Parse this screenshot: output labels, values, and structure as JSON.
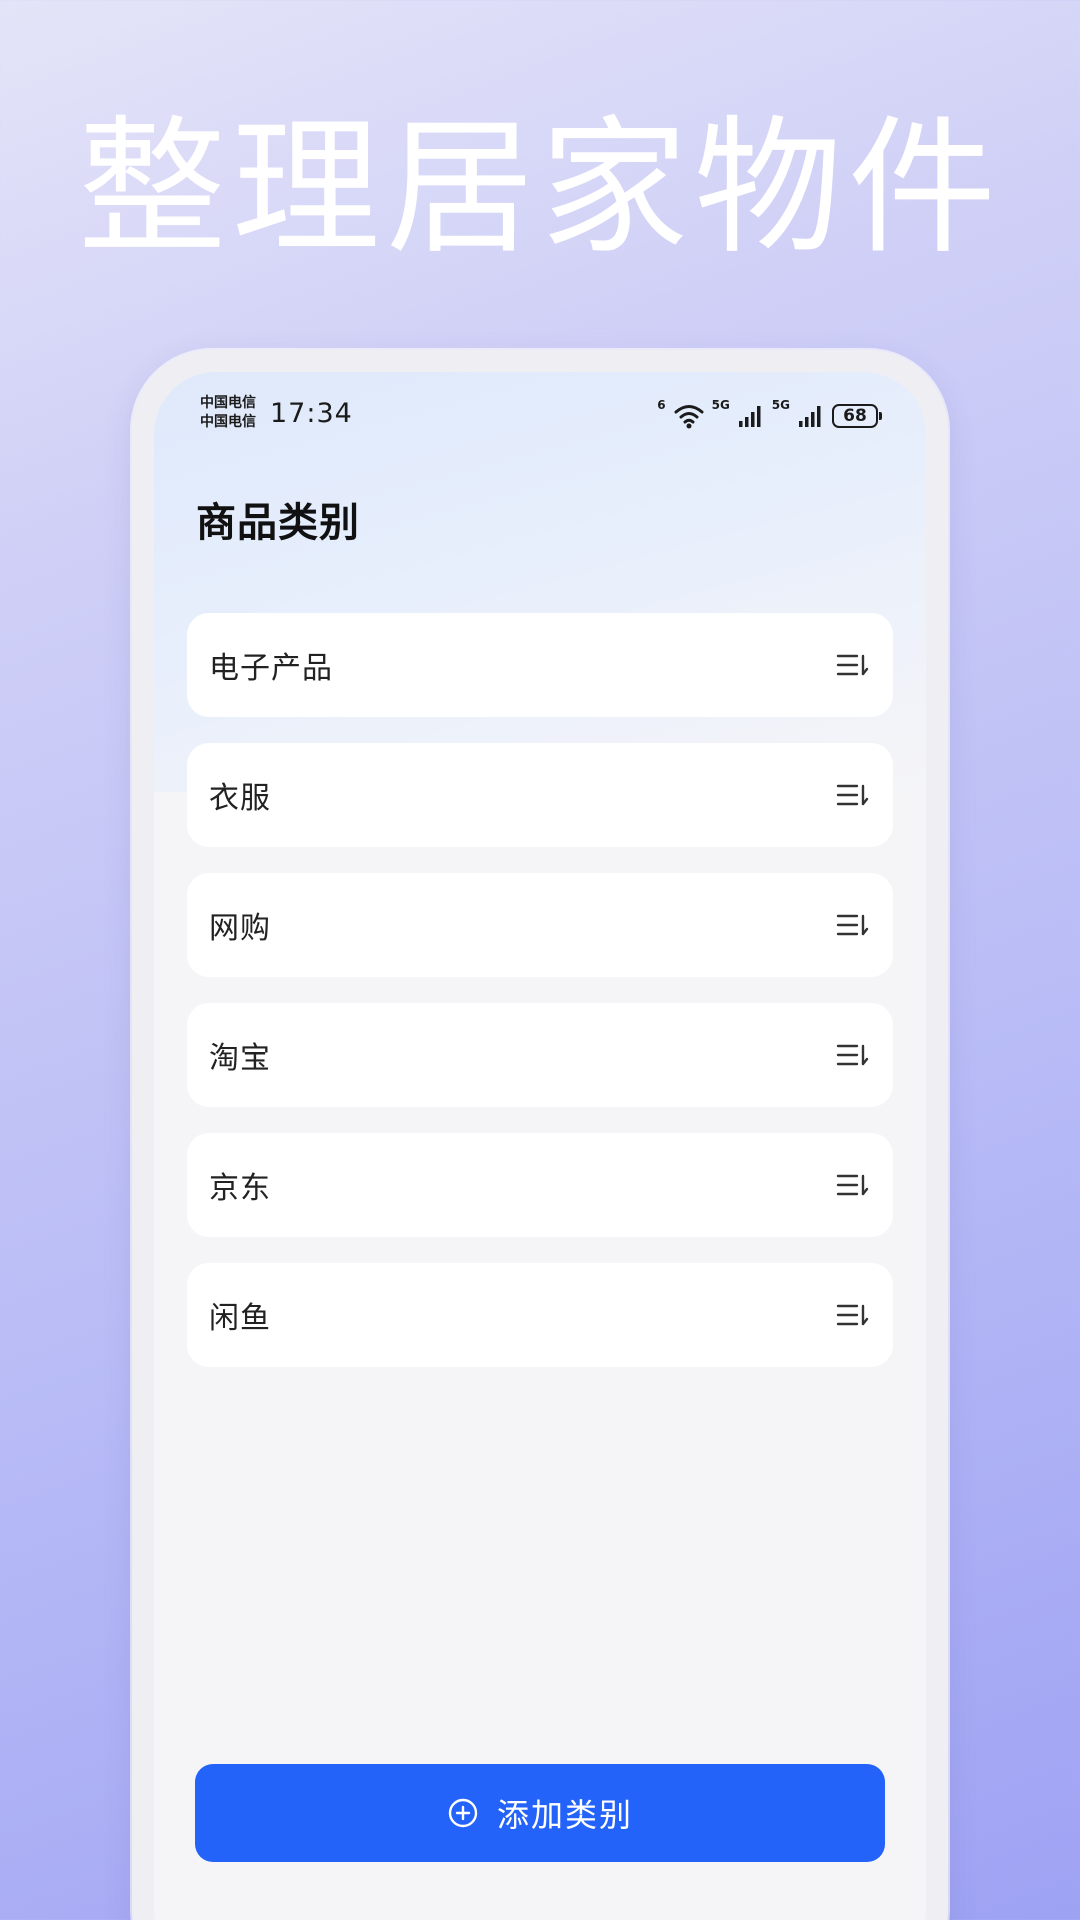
{
  "headline": "整理居家物件",
  "status_bar": {
    "carrier_1": "中国电信",
    "carrier_2": "中国电信",
    "time": "17:34",
    "wifi_label": "6",
    "sim1_label": "5G",
    "sim2_label": "5G",
    "battery": "68"
  },
  "page": {
    "title": "商品类别"
  },
  "categories": [
    {
      "label": "电子产品",
      "icon": "sort-icon"
    },
    {
      "label": "衣服",
      "icon": "sort-icon"
    },
    {
      "label": "网购",
      "icon": "sort-icon"
    },
    {
      "label": "淘宝",
      "icon": "sort-icon"
    },
    {
      "label": "京东",
      "icon": "sort-icon"
    },
    {
      "label": "闲鱼",
      "icon": "sort-icon"
    }
  ],
  "actions": {
    "add_category_label": "添加类别",
    "add_icon": "plus-circle-icon"
  },
  "colors": {
    "accent": "#2463fa",
    "card_background": "#ffffff",
    "screen_background": "#f5f5f8"
  }
}
